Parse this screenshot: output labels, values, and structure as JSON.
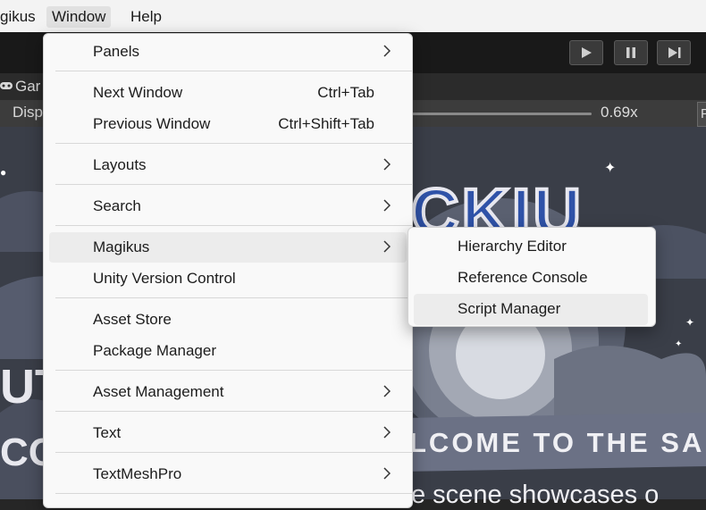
{
  "menubar": {
    "items": [
      {
        "label": "gikus"
      },
      {
        "label": "Window"
      },
      {
        "label": "Help"
      }
    ]
  },
  "playmode": {
    "play_icon": "play-icon",
    "pause_icon": "pause-icon",
    "step_icon": "step-icon"
  },
  "game_view": {
    "tab_label": "Gar",
    "display_label": "Disp",
    "scale_value": "0.69x",
    "right_button": "P",
    "art": {
      "title": "CKIU",
      "left_text_1": "UTI",
      "left_text_2": "CO",
      "ribbon_text": "LCOME TO THE SA",
      "subtitle": "e scene showcases o"
    }
  },
  "window_menu": {
    "items": [
      {
        "label": "Panels",
        "shortcut": "",
        "submenu": true
      },
      {
        "label": "Next Window",
        "shortcut": "Ctrl+Tab",
        "submenu": false
      },
      {
        "label": "Previous Window",
        "shortcut": "Ctrl+Shift+Tab",
        "submenu": false
      },
      {
        "label": "Layouts",
        "shortcut": "",
        "submenu": true
      },
      {
        "label": "Search",
        "shortcut": "",
        "submenu": true
      },
      {
        "label": "Magikus",
        "shortcut": "",
        "submenu": true
      },
      {
        "label": "Unity Version Control",
        "shortcut": "",
        "submenu": false
      },
      {
        "label": "Asset Store",
        "shortcut": "",
        "submenu": false
      },
      {
        "label": "Package Manager",
        "shortcut": "",
        "submenu": false
      },
      {
        "label": "Asset Management",
        "shortcut": "",
        "submenu": true
      },
      {
        "label": "Text",
        "shortcut": "",
        "submenu": true
      },
      {
        "label": "TextMeshPro",
        "shortcut": "",
        "submenu": true
      }
    ]
  },
  "magikus_submenu": {
    "items": [
      {
        "label": "Hierarchy Editor"
      },
      {
        "label": "Reference Console"
      },
      {
        "label": "Script Manager"
      }
    ]
  }
}
